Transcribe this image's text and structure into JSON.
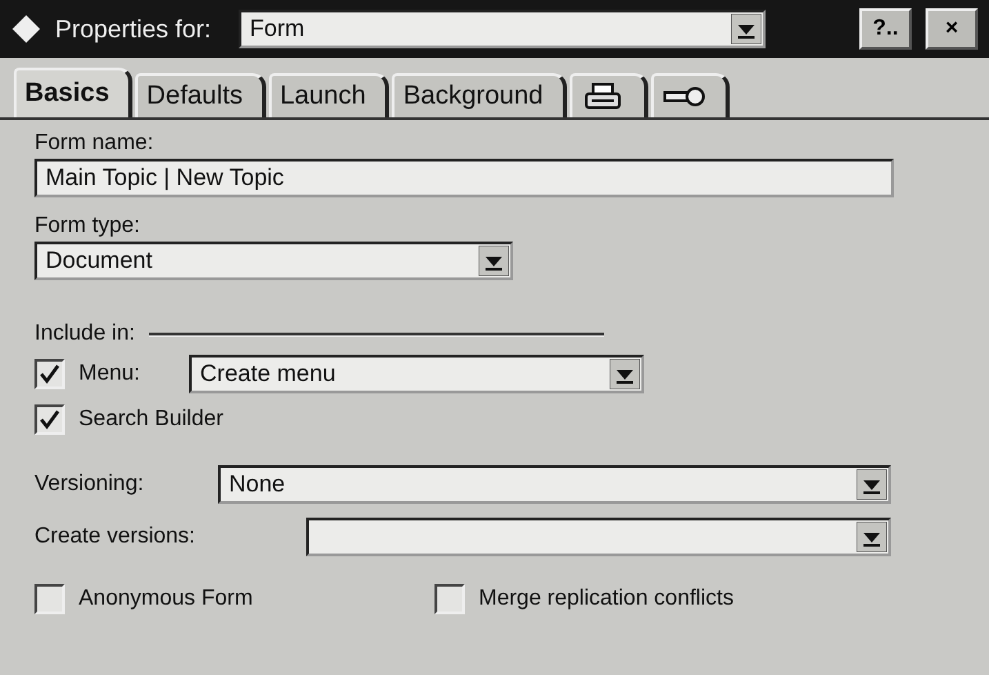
{
  "window": {
    "title": "Properties for:",
    "object": "Form",
    "help_button": "?..",
    "close_button": "×"
  },
  "tabs": [
    {
      "kind": "text",
      "label": "Basics",
      "selected": true
    },
    {
      "kind": "text",
      "label": "Defaults",
      "selected": false
    },
    {
      "kind": "text",
      "label": "Launch",
      "selected": false
    },
    {
      "kind": "text",
      "label": "Background",
      "selected": false
    },
    {
      "kind": "printer",
      "selected": false
    },
    {
      "kind": "key",
      "selected": false
    }
  ],
  "form_name": {
    "label": "Form name:",
    "value": "Main Topic | New Topic"
  },
  "form_type": {
    "label": "Form type:",
    "value": "Document"
  },
  "include_in": {
    "label": "Include in:",
    "menu": {
      "label": "Menu:",
      "checked": true,
      "value": "Create menu"
    },
    "search_builder": {
      "label": "Search Builder",
      "checked": true
    }
  },
  "versioning": {
    "label": "Versioning:",
    "value": "None"
  },
  "create_versions": {
    "label": "Create versions:"
  },
  "options": [
    {
      "label": "Anonymous Form",
      "checked": false
    },
    {
      "label": "Merge replication conflicts",
      "checked": false
    }
  ]
}
